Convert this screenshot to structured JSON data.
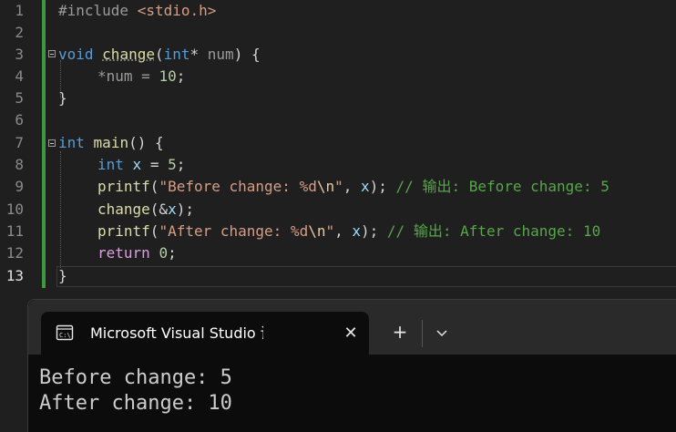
{
  "editor": {
    "line_numbers": [
      "1",
      "2",
      "3",
      "4",
      "5",
      "6",
      "7",
      "8",
      "9",
      "10",
      "11",
      "12",
      "13"
    ],
    "current_line": "13",
    "lines": {
      "l1": {
        "directive": "#include",
        "header": "<stdio.h>"
      },
      "l3": {
        "kw": "void",
        "fn": "change",
        "open": "(",
        "type": "int",
        "ptr": "* ",
        "param": "num",
        "close": ") {"
      },
      "l4": {
        "text": "*num = ",
        "num": "10",
        "end": ";"
      },
      "l5": {
        "text": "}"
      },
      "l7": {
        "kw": "int",
        "fn": "main",
        "rest": "() {"
      },
      "l8": {
        "kw": "int",
        "var": "x",
        "eq": " = ",
        "num": "5",
        "end": ";"
      },
      "l9": {
        "fn": "printf",
        "open": "(",
        "str1": "\"Before change: %d",
        "esc": "\\n",
        "str2": "\"",
        "mid": ", ",
        "var": "x",
        "end": "); ",
        "comment": "// 输出: Before change: 5"
      },
      "l10": {
        "fn": "change",
        "open": "(&",
        "var": "x",
        "end": ");"
      },
      "l11": {
        "fn": "printf",
        "open": "(",
        "str1": "\"After change: %d",
        "esc": "\\n",
        "str2": "\"",
        "mid": ", ",
        "var": "x",
        "end": "); ",
        "comment": "// 输出: After change: 10"
      },
      "l12": {
        "kw": "return",
        "num": "0",
        "end": ";"
      },
      "l13": {
        "text": "}"
      }
    }
  },
  "terminal": {
    "tab_title": "Microsoft Visual Studio 调试控制台",
    "tab_icon": "terminal-icon",
    "close_glyph": "✕",
    "new_tab_glyph": "+",
    "output": [
      "Before change: 5",
      "After change: 10"
    ]
  },
  "colors": {
    "change_bar": "#3c9a3c",
    "keyword": "#569cd6",
    "function": "#dcdcaa",
    "string": "#d69d85",
    "comment": "#57a64a",
    "control": "#d8a0df"
  }
}
